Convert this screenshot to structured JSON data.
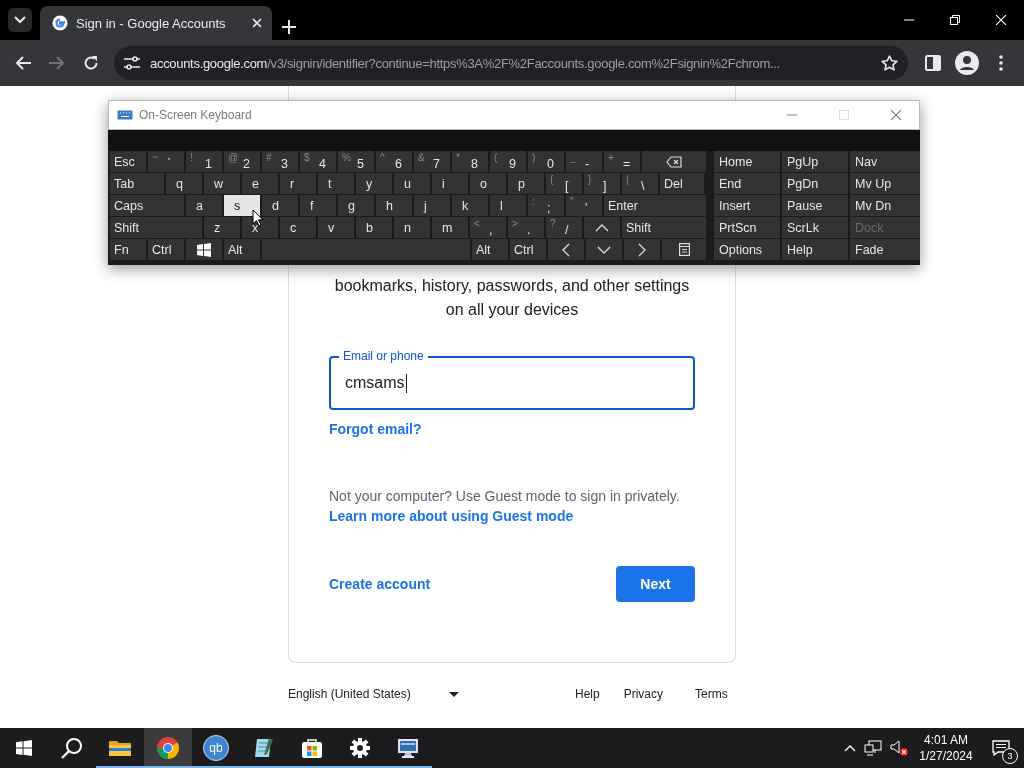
{
  "browser": {
    "tab": {
      "title": "Sign in - Google Accounts"
    },
    "url": {
      "host": "accounts.google.com",
      "path": "/v3/signin/identifier?continue=https%3A%2F%2Faccounts.google.com%2Fsignin%2Fchrom..."
    },
    "forward_disabled": true
  },
  "page": {
    "intro": "bookmarks, history, passwords, and other settings on all your devices",
    "email": {
      "label": "Email or phone",
      "value": "cmsams",
      "focused": true
    },
    "forgot_link": "Forgot email?",
    "guest_note": "Not your computer? Use Guest mode to sign in privately.",
    "guest_link": "Learn more about using Guest mode",
    "create_account": "Create account",
    "next": "Next",
    "footer": {
      "language": "English (United States)",
      "links": [
        "Help",
        "Privacy",
        "Terms"
      ]
    }
  },
  "keyboard": {
    "title": "On-Screen Keyboard",
    "rows": [
      [
        {
          "kind": "key",
          "label": "Esc",
          "pressed": false
        },
        {
          "kind": "key",
          "shift": "~",
          "label": "`",
          "pressed": false
        },
        {
          "kind": "key",
          "shift": "!",
          "label": "1",
          "pressed": false
        },
        {
          "kind": "key",
          "shift": "@",
          "label": "2",
          "pressed": false
        },
        {
          "kind": "key",
          "shift": "#",
          "label": "3",
          "pressed": false
        },
        {
          "kind": "key",
          "shift": "$",
          "label": "4",
          "pressed": false
        },
        {
          "kind": "key",
          "shift": "%",
          "label": "5",
          "pressed": false
        },
        {
          "kind": "key",
          "shift": "^",
          "label": "6",
          "pressed": false
        },
        {
          "kind": "key",
          "shift": "&",
          "label": "7",
          "pressed": false
        },
        {
          "kind": "key",
          "shift": "*",
          "label": "8",
          "pressed": false
        },
        {
          "kind": "key",
          "shift": "(",
          "label": "9",
          "pressed": false
        },
        {
          "kind": "key",
          "shift": ")",
          "label": "0",
          "pressed": false
        },
        {
          "kind": "key",
          "shift": "_",
          "label": "-",
          "pressed": false
        },
        {
          "kind": "key",
          "shift": "+",
          "label": "=",
          "pressed": false
        },
        {
          "kind": "backspace",
          "pressed": false
        }
      ],
      [
        {
          "kind": "key",
          "label": "Tab",
          "pressed": false
        },
        {
          "kind": "key",
          "label": "q",
          "pressed": false
        },
        {
          "kind": "key",
          "label": "w",
          "pressed": false
        },
        {
          "kind": "key",
          "label": "e",
          "pressed": false
        },
        {
          "kind": "key",
          "label": "r",
          "pressed": false
        },
        {
          "kind": "key",
          "label": "t",
          "pressed": false
        },
        {
          "kind": "key",
          "label": "y",
          "pressed": false
        },
        {
          "kind": "key",
          "label": "u",
          "pressed": false
        },
        {
          "kind": "key",
          "label": "i",
          "pressed": false
        },
        {
          "kind": "key",
          "label": "o",
          "pressed": false
        },
        {
          "kind": "key",
          "label": "p",
          "pressed": false
        },
        {
          "kind": "key",
          "shift": "{",
          "label": "[",
          "pressed": false
        },
        {
          "kind": "key",
          "shift": "}",
          "label": "]",
          "pressed": false
        },
        {
          "kind": "key",
          "shift": "|",
          "label": "\\",
          "pressed": false
        },
        {
          "kind": "key",
          "label": "Del",
          "pressed": false
        }
      ],
      [
        {
          "kind": "key",
          "label": "Caps",
          "pressed": false
        },
        {
          "kind": "key",
          "label": "a",
          "pressed": false
        },
        {
          "kind": "key",
          "label": "s",
          "pressed": true
        },
        {
          "kind": "key",
          "label": "d",
          "pressed": false
        },
        {
          "kind": "key",
          "label": "f",
          "pressed": false
        },
        {
          "kind": "key",
          "label": "g",
          "pressed": false
        },
        {
          "kind": "key",
          "label": "h",
          "pressed": false
        },
        {
          "kind": "key",
          "label": "j",
          "pressed": false
        },
        {
          "kind": "key",
          "label": "k",
          "pressed": false
        },
        {
          "kind": "key",
          "label": "l",
          "pressed": false
        },
        {
          "kind": "key",
          "shift": ":",
          "label": ";",
          "pressed": false
        },
        {
          "kind": "key",
          "shift": "\"",
          "label": "'",
          "pressed": false
        },
        {
          "kind": "key",
          "label": "Enter",
          "pressed": false
        }
      ],
      [
        {
          "kind": "key",
          "label": "Shift",
          "pressed": false
        },
        {
          "kind": "key",
          "label": "z",
          "pressed": false
        },
        {
          "kind": "key",
          "label": "x",
          "pressed": false
        },
        {
          "kind": "key",
          "label": "c",
          "pressed": false
        },
        {
          "kind": "key",
          "label": "v",
          "pressed": false
        },
        {
          "kind": "key",
          "label": "b",
          "pressed": false
        },
        {
          "kind": "key",
          "label": "n",
          "pressed": false
        },
        {
          "kind": "key",
          "label": "m",
          "pressed": false
        },
        {
          "kind": "key",
          "shift": "<",
          "label": ",",
          "pressed": false
        },
        {
          "kind": "key",
          "shift": ">",
          "label": ".",
          "pressed": false
        },
        {
          "kind": "key",
          "shift": "?",
          "label": "/",
          "pressed": false
        },
        {
          "kind": "up",
          "pressed": false
        },
        {
          "kind": "key",
          "label": "Shift",
          "pressed": false
        }
      ],
      [
        {
          "kind": "key",
          "label": "Fn",
          "pressed": false
        },
        {
          "kind": "key",
          "label": "Ctrl",
          "pressed": false
        },
        {
          "kind": "windows",
          "pressed": false
        },
        {
          "kind": "key",
          "label": "Alt",
          "pressed": false
        },
        {
          "kind": "space",
          "pressed": false
        },
        {
          "kind": "key",
          "label": "Alt",
          "pressed": false
        },
        {
          "kind": "key",
          "label": "Ctrl",
          "pressed": false
        },
        {
          "kind": "left",
          "pressed": false
        },
        {
          "kind": "down",
          "pressed": false
        },
        {
          "kind": "right",
          "pressed": false
        },
        {
          "kind": "menu",
          "pressed": false
        }
      ]
    ],
    "nav_keys": [
      {
        "label": "Home",
        "disabled": false
      },
      {
        "label": "PgUp",
        "disabled": false
      },
      {
        "label": "Nav",
        "disabled": false
      },
      {
        "label": "End",
        "disabled": false
      },
      {
        "label": "PgDn",
        "disabled": false
      },
      {
        "label": "Mv Up",
        "disabled": false
      },
      {
        "label": "Insert",
        "disabled": false
      },
      {
        "label": "Pause",
        "disabled": false
      },
      {
        "label": "Mv Dn",
        "disabled": false
      },
      {
        "label": "PrtScn",
        "disabled": false
      },
      {
        "label": "ScrLk",
        "disabled": false
      },
      {
        "label": "Dock",
        "disabled": true
      },
      {
        "label": "Options",
        "disabled": false
      },
      {
        "label": "Help",
        "disabled": false
      },
      {
        "label": "Fade",
        "disabled": false
      }
    ]
  },
  "taskbar": {
    "apps": [
      {
        "running": true,
        "selected": false
      },
      {
        "running": true,
        "selected": true
      },
      {
        "running": true,
        "selected": false,
        "label": "qb"
      },
      {
        "running": true,
        "selected": false
      },
      {
        "running": true,
        "selected": false
      },
      {
        "running": true,
        "selected": false
      },
      {
        "running": true,
        "selected": false
      }
    ],
    "time": "4:01 AM",
    "date": "1/27/2024",
    "notifications": "3"
  }
}
